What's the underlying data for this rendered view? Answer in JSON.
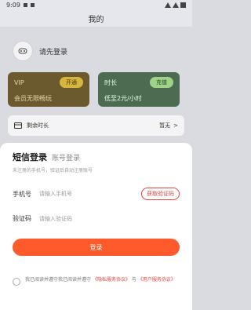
{
  "status_bar": {
    "time": "9:09"
  },
  "header": {
    "title": "我的"
  },
  "profile": {
    "login_prompt": "请先登录"
  },
  "cards": {
    "vip": {
      "title": "VIP",
      "button": "开通",
      "subtitle": "会员无限畅玩"
    },
    "time": {
      "title": "时长",
      "button": "充值",
      "subtitle": "低至2元/小时"
    }
  },
  "remaining": {
    "label": "剩余时长",
    "value": "暂无",
    "chevron": ">"
  },
  "login_modal": {
    "tab_sms": "短信登录",
    "tab_account": "账号登录",
    "hint": "未注册的手机号，验证后自动注册账号",
    "phone_label": "手机号",
    "phone_placeholder": "请输入手机号",
    "code_button": "获取验证码",
    "code_label": "验证码",
    "code_placeholder": "请输入验证码",
    "login_button": "登录",
    "agreement_prefix": "我已阅读并遵守我已阅读并遵守",
    "privacy_link": "《隐私服务协议》",
    "and": "与",
    "user_link": "《用户服务协议》"
  }
}
